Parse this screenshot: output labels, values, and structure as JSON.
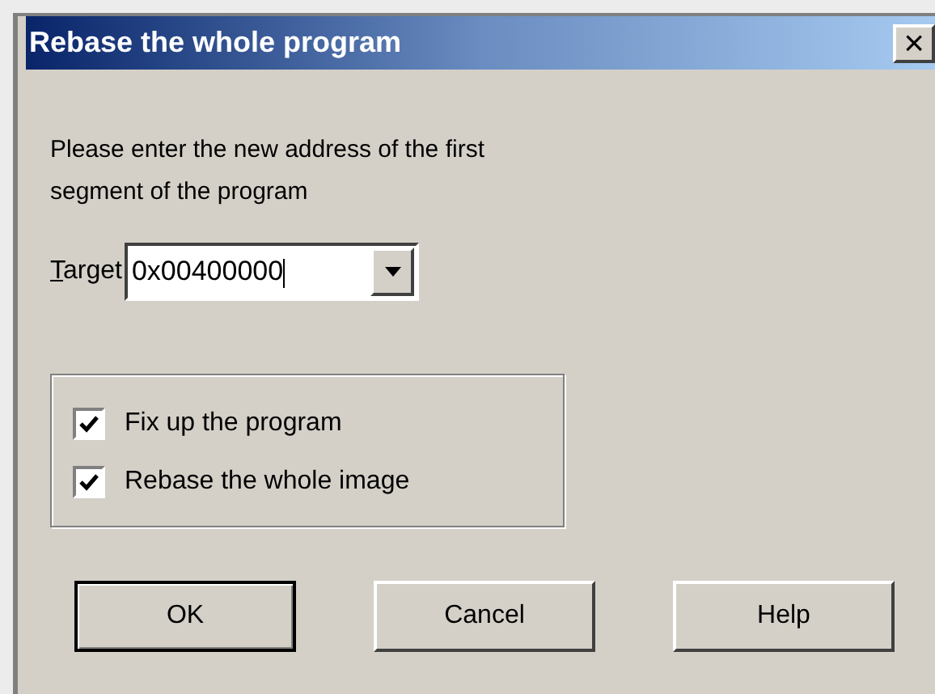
{
  "window": {
    "title": "Rebase the whole program",
    "close": "×"
  },
  "prompt": "Please enter the new address of the first segment of the program",
  "target": {
    "label": "Target",
    "value": "0x00400000"
  },
  "options": [
    {
      "label": "Fix up the program",
      "checked": true
    },
    {
      "label": "Rebase the whole image",
      "checked": true
    }
  ],
  "buttons": [
    {
      "label": "OK",
      "default": true
    },
    {
      "label": "Cancel",
      "default": false
    },
    {
      "label": "Help",
      "default": false
    }
  ]
}
